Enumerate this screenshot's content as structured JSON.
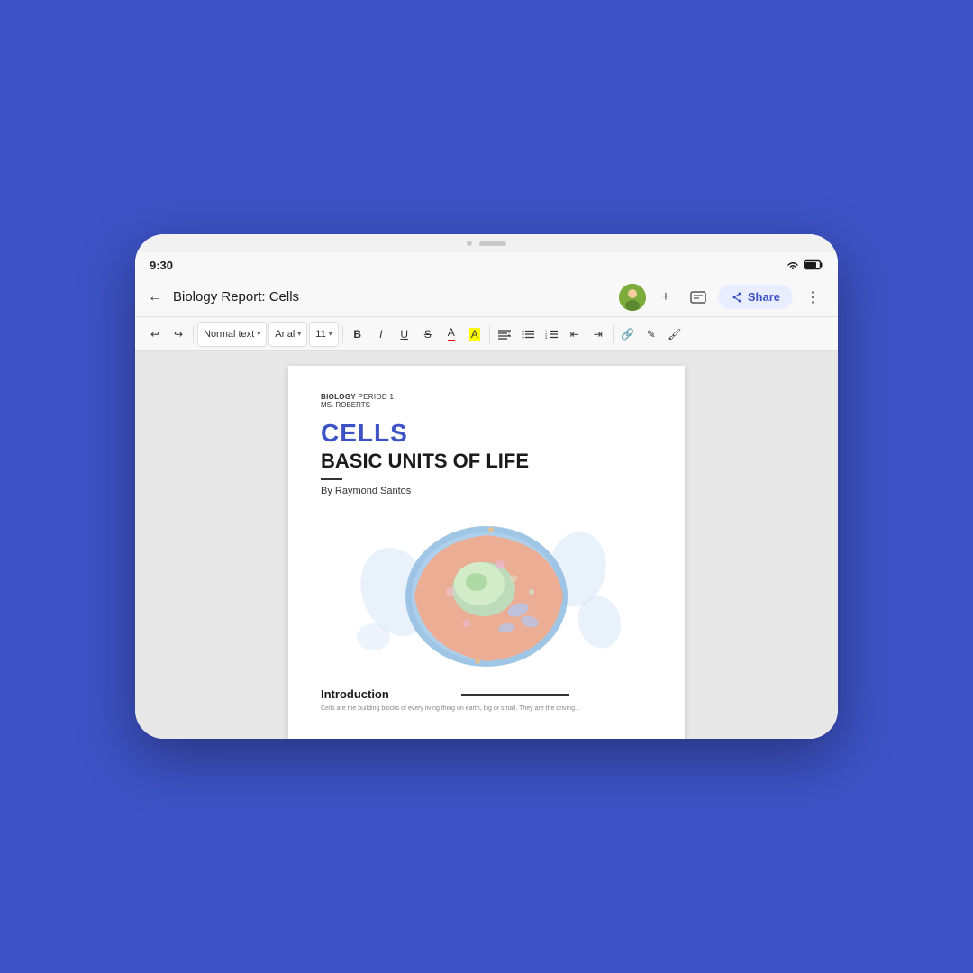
{
  "background_color": "#3d52c4",
  "tablet": {
    "status_bar": {
      "time": "9:30",
      "wifi": true,
      "battery": true
    },
    "nav_bar": {
      "back_label": "←",
      "doc_title": "Biology Report: Cells",
      "share_label": "Share",
      "more_icon": "⋮",
      "add_icon": "+",
      "comments_icon": "☰"
    },
    "toolbar": {
      "undo": "↩",
      "redo": "↪",
      "style_dropdown": "Normal text",
      "font_dropdown": "Arial",
      "size_dropdown": "11",
      "bold": "B",
      "italic": "I",
      "underline": "U",
      "strikethrough": "S",
      "text_color": "A",
      "highlight": "A",
      "align": "≡",
      "more_align": "≡",
      "bullet_list": "≡",
      "numbered_list": "≡",
      "indent_less": "⇤",
      "indent_more": "⇥",
      "link": "🔗",
      "comment": "✎",
      "format_paint": "🖌"
    },
    "document": {
      "meta_line1_bold": "BIOLOGY",
      "meta_line1_rest": " PERIOD 1",
      "meta_line2": "MS. ROBERTS",
      "title": "CELLS",
      "subtitle": "BASIC UNITS OF LIFE",
      "author": "By Raymond Santos",
      "intro_heading": "Introduction",
      "intro_text": "Cells are the building blocks of every living thing on earth, big or small. They are the driving..."
    }
  }
}
